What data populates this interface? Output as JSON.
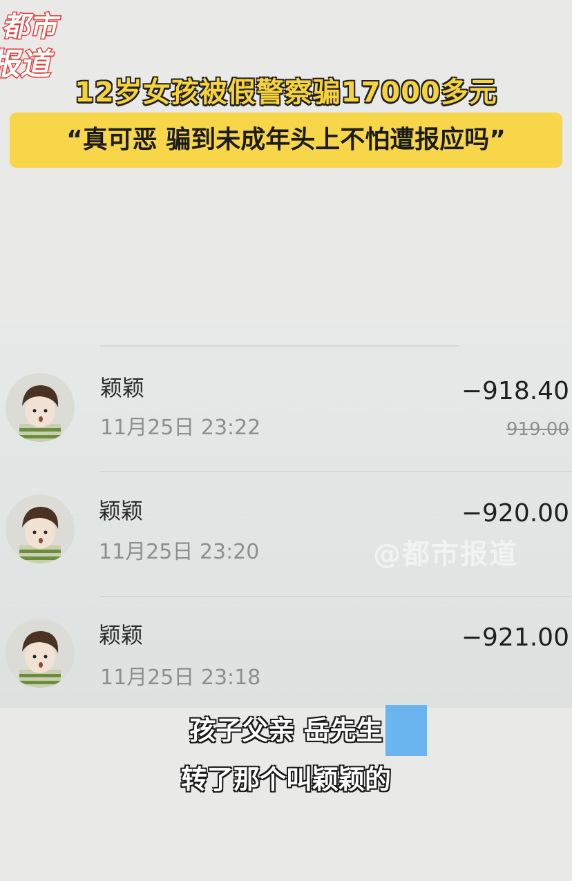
{
  "header": {
    "logo_text": "都市报道",
    "headline": "12岁女孩被假警察骗17000多元",
    "quote": "“真可恶 骗到未成年头上不怕遭报应吗”"
  },
  "transactions": [
    {
      "name": "颖颖",
      "time": "11月25日 23:22",
      "amount": "−918.40",
      "original_amount": "919.00"
    },
    {
      "name": "颖颖",
      "time": "11月25日 23:20",
      "amount": "−920.00"
    },
    {
      "name": "颖颖",
      "time": "11月25日 23:18",
      "amount": "−921.00"
    }
  ],
  "watermark": "@都市报道",
  "subtitles": {
    "line1": "孩子父亲 岳先生",
    "line2": "转了那个叫颖颖的"
  },
  "colors": {
    "headline_yellow": "#f6d23b",
    "banner_yellow": "#f7d64a",
    "logo_red": "#e23a3a",
    "accent_blue": "#6ab4ef"
  }
}
